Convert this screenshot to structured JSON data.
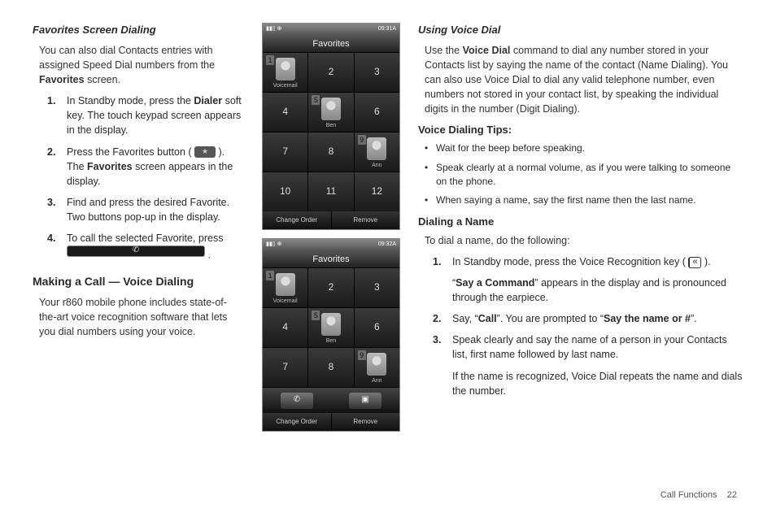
{
  "footer": {
    "section": "Call Functions",
    "page": "22"
  },
  "left": {
    "h1": "Favorites Screen Dialing",
    "intro_a": "You can also dial Contacts entries with assigned Speed Dial numbers from the ",
    "intro_b": "Favorites",
    "intro_c": " screen.",
    "s1_a": "In Standby mode, press the ",
    "s1_b": "Dialer",
    "s1_c": " soft key. The touch keypad screen appears in the display.",
    "s2_a": "Press the Favorites button ( ",
    "s2_b": " ). The ",
    "s2_c": "Favorites",
    "s2_d": " screen appears in the display.",
    "s3": "Find and press the desired Favorite. Two buttons pop-up in the display.",
    "s4_a": "To call the selected Favorite, press ",
    "s4_b": " .",
    "h2": "Making a Call — Voice Dialing",
    "p2": "Your r860 mobile phone includes state-of-the-art voice recognition software that lets you dial numbers using your voice."
  },
  "right": {
    "h1": "Using Voice Dial",
    "p1_a": "Use the ",
    "p1_b": "Voice Dial",
    "p1_c": " command to dial any number stored in your Contacts list by saying the name of the contact (Name Dialing). You can also use Voice Dial to dial any valid telephone number, even numbers not stored in your contact list, by speaking the individual digits in the number (Digit Dialing).",
    "tips_h": "Voice Dialing Tips:",
    "tip1": "Wait for the beep before speaking.",
    "tip2": "Speak clearly at a normal volume, as if you were talking to someone on the phone.",
    "tip3": "When saying a name, say the first name then the last name.",
    "dial_h": "Dialing a Name",
    "dial_p": "To dial a name, do the following:",
    "d1_a": "In Standby mode, press the Voice Recognition key ( ",
    "d1_b": " ).",
    "d1_sub_a": "“",
    "d1_sub_b": "Say a Command",
    "d1_sub_c": "” appears in the display and is pronounced through the earpiece.",
    "d2_a": "Say, “",
    "d2_b": "Call",
    "d2_c": "”. You are prompted to “",
    "d2_d": "Say the name or #",
    "d2_e": "”.",
    "d3": "Speak clearly and say the name of a person in your Contacts list, first name followed by last name.",
    "d3_sub": "If the name is recognized, Voice Dial repeats the name and dials the number."
  },
  "phone": {
    "time1": "09:31A",
    "time2": "09:32A",
    "title": "Favorites",
    "voicemail": "Voicemail",
    "ben": "Ben",
    "ann": "Ann",
    "change": "Change Order",
    "remove": "Remove"
  }
}
